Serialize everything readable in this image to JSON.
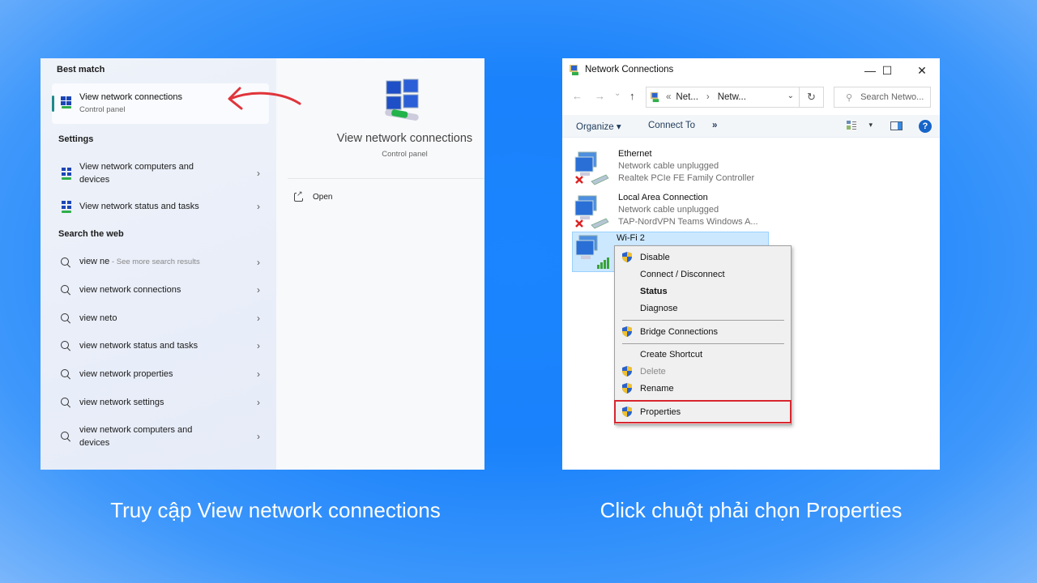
{
  "search_panel": {
    "best_match": {
      "section_title": "Best match",
      "title": "View network connections",
      "subtitle": "Control panel",
      "icon": "network-connections-icon"
    },
    "settings": {
      "section_title": "Settings",
      "items": [
        {
          "label": "View network computers and devices",
          "icon": "network-icon"
        },
        {
          "label": "View network status and tasks",
          "icon": "network-icon"
        }
      ]
    },
    "web": {
      "section_title": "Search the web",
      "items": [
        {
          "label": "view ne",
          "suffix": " - See more search results"
        },
        {
          "label": "view network connections"
        },
        {
          "label": "view neto"
        },
        {
          "label": "view network status and tasks"
        },
        {
          "label": "view network properties"
        },
        {
          "label": "view network settings"
        },
        {
          "label": "view network computers and devices"
        }
      ]
    },
    "detail": {
      "title": "View network connections",
      "subtitle": "Control panel",
      "open_label": "Open"
    },
    "chevron": "›"
  },
  "window": {
    "title": "Network Connections",
    "controls": {
      "minimize": "—",
      "maximize": "☐",
      "close": "✕"
    },
    "nav": {
      "back": "←",
      "forward": "→",
      "recent": "⌄",
      "up": "↑"
    },
    "address": {
      "prefix": "«",
      "crumbs": [
        "Net...",
        "Netw..."
      ],
      "separator": "›",
      "dropdown": "⌄",
      "refresh": "↻"
    },
    "search_placeholder": "Search Netwo...",
    "commands": {
      "organize": "Organize ▾",
      "connect_to": "Connect To",
      "more": "»",
      "view_dropdown": "▾",
      "help": "?"
    },
    "connections": [
      {
        "name": "Ethernet",
        "status": "Network cable unplugged",
        "device": "Realtek PCIe FE Family Controller",
        "state": "disconnected"
      },
      {
        "name": "Local Area Connection",
        "status": "Network cable unplugged",
        "device": "TAP-NordVPN Teams Windows A...",
        "state": "disconnected"
      },
      {
        "name": "Wi-Fi 2",
        "status": "",
        "device": "",
        "state": "connected",
        "selected": true
      }
    ],
    "context_menu": [
      {
        "label": "Disable",
        "shield": true
      },
      {
        "label": "Connect / Disconnect",
        "shield": false
      },
      {
        "label": "Status",
        "shield": false,
        "bold": true
      },
      {
        "label": "Diagnose",
        "shield": false
      },
      {
        "label": "Bridge Connections",
        "shield": true
      },
      {
        "label": "Create Shortcut",
        "shield": false
      },
      {
        "label": "Delete",
        "shield": true,
        "disabled": true
      },
      {
        "label": "Rename",
        "shield": true
      },
      {
        "label": "Properties",
        "shield": true,
        "highlighted": true
      }
    ]
  },
  "captions": {
    "left": "Truy cập View network connections",
    "right": "Click chuột phải chọn Properties"
  },
  "colors": {
    "background": "#1a85ff",
    "highlight_box": "#d8262e",
    "arrow": "#e0343a",
    "selection": "#cce8ff"
  }
}
